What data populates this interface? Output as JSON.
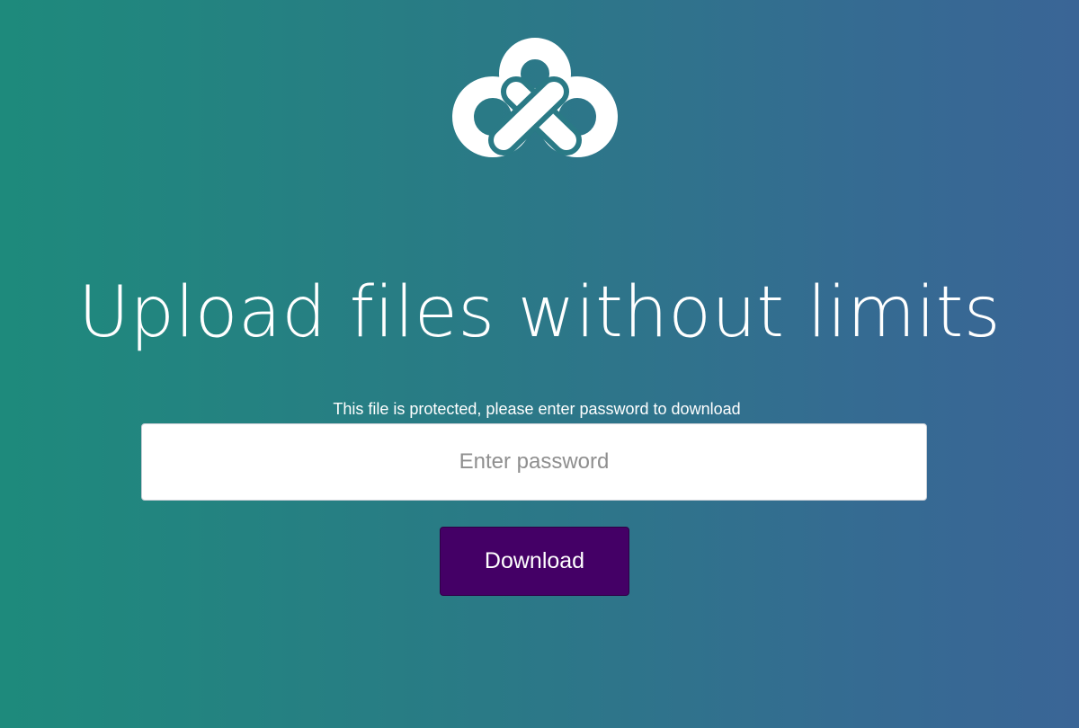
{
  "logo": {
    "icon": "cloud-knot-logo-icon",
    "color": "#ffffff"
  },
  "headline": "Upload files without limits",
  "notice": "This file is protected, please enter password to download",
  "password": {
    "placeholder": "Enter password",
    "value": ""
  },
  "download_label": "Download",
  "colors": {
    "gradient_start": "#1e8a7c",
    "gradient_end": "#3a6596",
    "button": "#440066"
  }
}
